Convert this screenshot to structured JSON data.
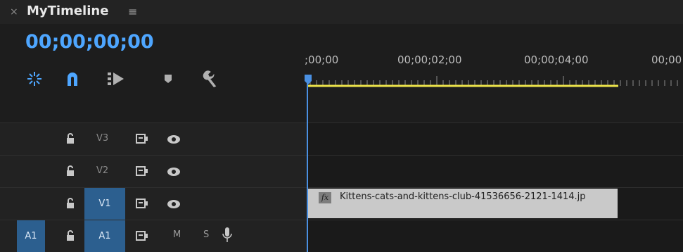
{
  "header": {
    "close_glyph": "×",
    "title": "MyTimeline",
    "menu_glyph": "≡"
  },
  "timecode": "00;00;00;00",
  "toolbar": {
    "icons": [
      "snap-icon",
      "linked-selection-icon",
      "insert-icon",
      "add-marker-icon",
      "wrench-icon"
    ]
  },
  "ruler": {
    "labels": [
      ";00;00",
      "00;00;02;00",
      "00;00;04;00",
      "00;00"
    ],
    "in_out_bar_color": "#ede44a",
    "playhead_color": "#4a90e2"
  },
  "tracks": [
    {
      "label": "V3",
      "selected": false
    },
    {
      "label": "V2",
      "selected": false
    },
    {
      "label": "V1",
      "selected": true
    }
  ],
  "audio_track": {
    "source_label": "A1",
    "label": "A1",
    "mute": "M",
    "solo": "S"
  },
  "clip": {
    "fx_label": "fx",
    "name": "Kittens-cats-and-kittens-club-41536656-2121-1414.jp"
  }
}
